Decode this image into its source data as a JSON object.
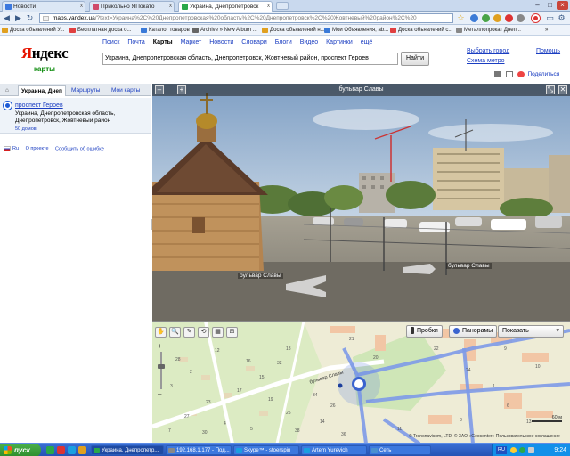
{
  "browser": {
    "tabs": [
      {
        "label": "Новости",
        "favicon_color": "#3c78de",
        "active": false
      },
      {
        "label": "Прикольно ЯПокато",
        "favicon_color": "#d04a6a",
        "active": false
      },
      {
        "label": "Украина, Днепропетровск",
        "favicon_color": "#2aa84a",
        "active": true
      }
    ],
    "close_glyph": "x",
    "window_controls": [
      "–",
      "□",
      "×"
    ],
    "url_host": "maps.yandex.ua",
    "url_path": "/?text=Украина%2C%20Днепропетровская%20область%2C%20Днепропетровск%2C%20Жовтневый%20район%2C%20"
  },
  "bookmarks": [
    {
      "label": "Доска объявлений У...",
      "color": "#e0a020"
    },
    {
      "label": "Бесплатная доска о...",
      "color": "#e04040"
    },
    {
      "label": "Каталог товаров",
      "color": "#3a7ad8"
    },
    {
      "label": "Archive » New Album ...",
      "color": "#666"
    },
    {
      "label": "Доска объявлений н...",
      "color": "#e0a020"
    },
    {
      "label": "Мои Объявления, ab...",
      "color": "#3a7ad8"
    },
    {
      "label": "Доска объявлений с...",
      "color": "#e04040"
    },
    {
      "label": "Металлопрокат Днеп...",
      "color": "#888"
    }
  ],
  "header": {
    "logo_pre": "Я",
    "logo_rest": "ндекс",
    "logo_sub": "карты",
    "services": [
      "Поиск",
      "Почта",
      "Карты",
      "Маркет",
      "Новости",
      "Словари",
      "Блоги",
      "Видео",
      "Картинки",
      "ещё"
    ],
    "current_service": "Карты",
    "search_value": "Украина, Днепропетровская область, Днепропетровск, Жовтневый район, проспект Героев",
    "find_label": "Найти",
    "right_links": {
      "city": "Выбрать город",
      "help": "Помощь",
      "metro": "Схема метро"
    },
    "share_label": "Поделиться"
  },
  "left_panel": {
    "tabs": [
      "Украина, Днеп",
      "Маршруты",
      "Мои карты"
    ],
    "home_glyph": "⌂",
    "result_title": "проспект Героев",
    "result_address": "Украина, Днепропетровская область, Днепропетровск, Жовтневый район",
    "result_houses": "50 домов",
    "footer": {
      "lang": "Ru",
      "about": "О проекте",
      "report": "Сообщить об ошибке"
    },
    "collapse_glyph": "◂"
  },
  "panorama": {
    "title": "бульвар Славы",
    "street_labels": [
      "бульвар Славы",
      "бульвар Славы"
    ],
    "buttons": [
      "–",
      "+"
    ],
    "right_buttons": [
      "⤡",
      "✕"
    ]
  },
  "map": {
    "tools": [
      "✋",
      "🔍",
      "✎",
      "⟲",
      "▦",
      "⊞"
    ],
    "zoom_glyphs": [
      "+",
      "–"
    ],
    "traffic_label": "Пробки",
    "panoramas_label": "Панорамы",
    "show_label": "Показать",
    "street_label": "бульвар Славы",
    "scale_label": "60 м",
    "copyright": "© Transnavicom, LTD, © ЗАО «Geocenter»  Пользовательское соглашение",
    "house_numbers": [
      "21",
      "18",
      "20",
      "22",
      "16",
      "12",
      "24",
      "15",
      "17",
      "19",
      "23",
      "25",
      "27",
      "6",
      "2",
      "3",
      "4",
      "5",
      "8",
      "7",
      "9",
      "10",
      "11",
      "13",
      "14",
      "1",
      "38",
      "26",
      "28",
      "30",
      "32",
      "34",
      "36"
    ]
  },
  "taskbar": {
    "start_label": "пуск",
    "tasks": [
      {
        "label": "Украина, Днепропетр...",
        "color": "#2aa84a",
        "active": true
      },
      {
        "label": "192.168.1.177 - Под...",
        "color": "#888",
        "active": false
      },
      {
        "label": "Skype™ - stoerspin",
        "color": "#1aa0e0",
        "active": false
      },
      {
        "label": "Artem Yurevich",
        "color": "#1aa0e0",
        "active": false
      },
      {
        "label": "Сеть",
        "color": "#4a90d0",
        "active": false
      }
    ],
    "lang": "RU",
    "clock": "9:24"
  }
}
